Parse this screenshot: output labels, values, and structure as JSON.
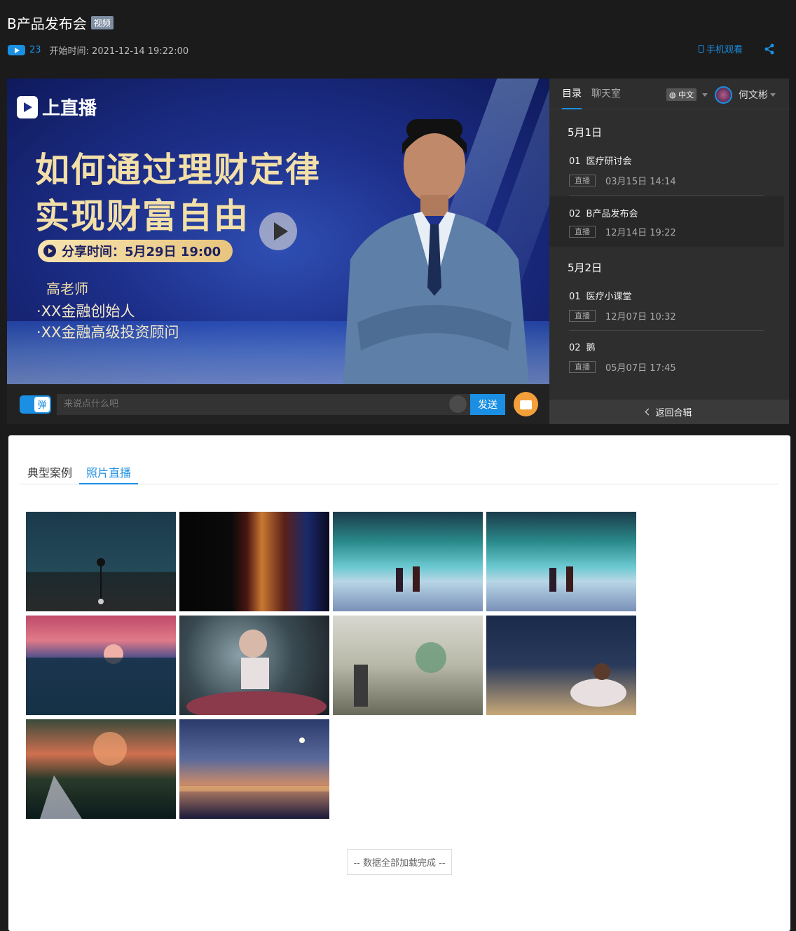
{
  "header": {
    "title": "B产品发布会",
    "badge": "视频",
    "views": "23",
    "start_time": "开始时间: 2021-12-14 19:22:00",
    "mobile_label": "手机观看"
  },
  "poster": {
    "brand": "上直播",
    "headline_line1": "如何通过理财定律",
    "headline_line2": "实现财富自由",
    "share_time": "分享时间：5月29日 19:00",
    "teacher": "高老师",
    "bullet1": "·XX金融创始人",
    "bullet2": "·XX金融高级投资顾问"
  },
  "chat": {
    "toggle_label": "弹",
    "placeholder": "来说点什么吧",
    "send_label": "发送"
  },
  "sidebar": {
    "tabs": [
      "目录",
      "聊天室"
    ],
    "language": "中文",
    "user_name": "何文彬",
    "groups": [
      {
        "date": "5月1日",
        "items": [
          {
            "num": "01",
            "title": "医疗研讨会",
            "tag": "直播",
            "time": "03月15日 14:14"
          },
          {
            "num": "02",
            "title": "B产品发布会",
            "tag": "直播",
            "time": "12月14日 19:22"
          }
        ]
      },
      {
        "date": "5月2日",
        "items": [
          {
            "num": "01",
            "title": "医疗小课堂",
            "tag": "直播",
            "time": "12月07日 10:32"
          },
          {
            "num": "02",
            "title": "鹅",
            "tag": "直播",
            "time": "05月07日 17:45"
          }
        ]
      }
    ],
    "back_label": "返回合辑"
  },
  "content": {
    "tabs": [
      "典型案例",
      "照片直播"
    ],
    "load_done": "-- 数据全部加载完成 --"
  },
  "colors": {
    "accent": "#1a8fe3",
    "bg": "#1b1b1b",
    "panel": "#2e2e2e"
  }
}
